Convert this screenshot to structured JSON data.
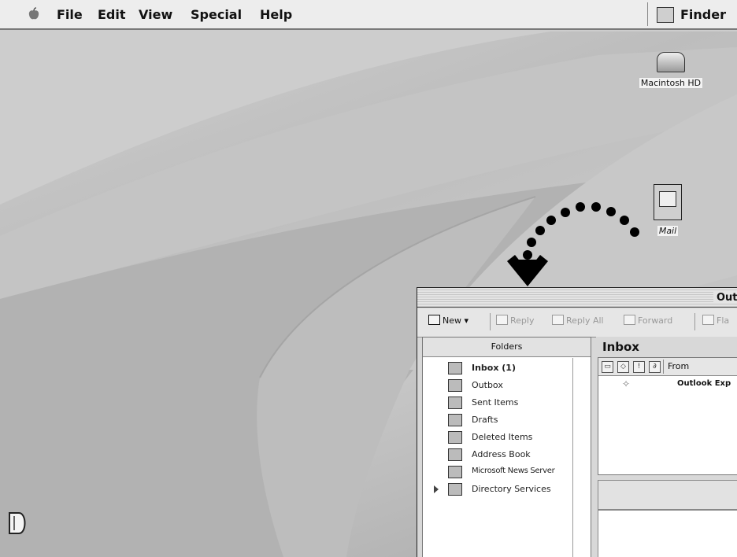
{
  "menubar": {
    "items": [
      "File",
      "Edit",
      "View",
      "Special",
      "Help"
    ],
    "active_app": "Finder"
  },
  "desktop": {
    "icons": [
      {
        "label": "Macintosh HD",
        "icon": "hard-disk-icon"
      },
      {
        "label": "Mail",
        "icon": "mail-icon"
      }
    ]
  },
  "outlook": {
    "title": "Outl",
    "toolbar": {
      "new_label": "New",
      "reply_label": "Reply",
      "reply_all_label": "Reply All",
      "forward_label": "Forward",
      "flag_label": "Fla"
    },
    "folders": {
      "header": "Folders",
      "items": [
        {
          "label": "Inbox (1)",
          "bold": true,
          "icon": "inbox-icon"
        },
        {
          "label": "Outbox",
          "icon": "outbox-icon"
        },
        {
          "label": "Sent Items",
          "icon": "sent-items-icon"
        },
        {
          "label": "Drafts",
          "icon": "drafts-icon"
        },
        {
          "label": "Deleted Items",
          "icon": "deleted-items-icon"
        },
        {
          "label": "Address Book",
          "icon": "address-book-icon"
        },
        {
          "label": "Microsoft News Server",
          "icon": "news-server-icon"
        },
        {
          "label": "Directory Services",
          "icon": "directory-services-icon"
        }
      ]
    },
    "inbox": {
      "title": "Inbox",
      "col_from": "From",
      "messages": [
        {
          "from": "Outlook Exp"
        }
      ]
    }
  }
}
